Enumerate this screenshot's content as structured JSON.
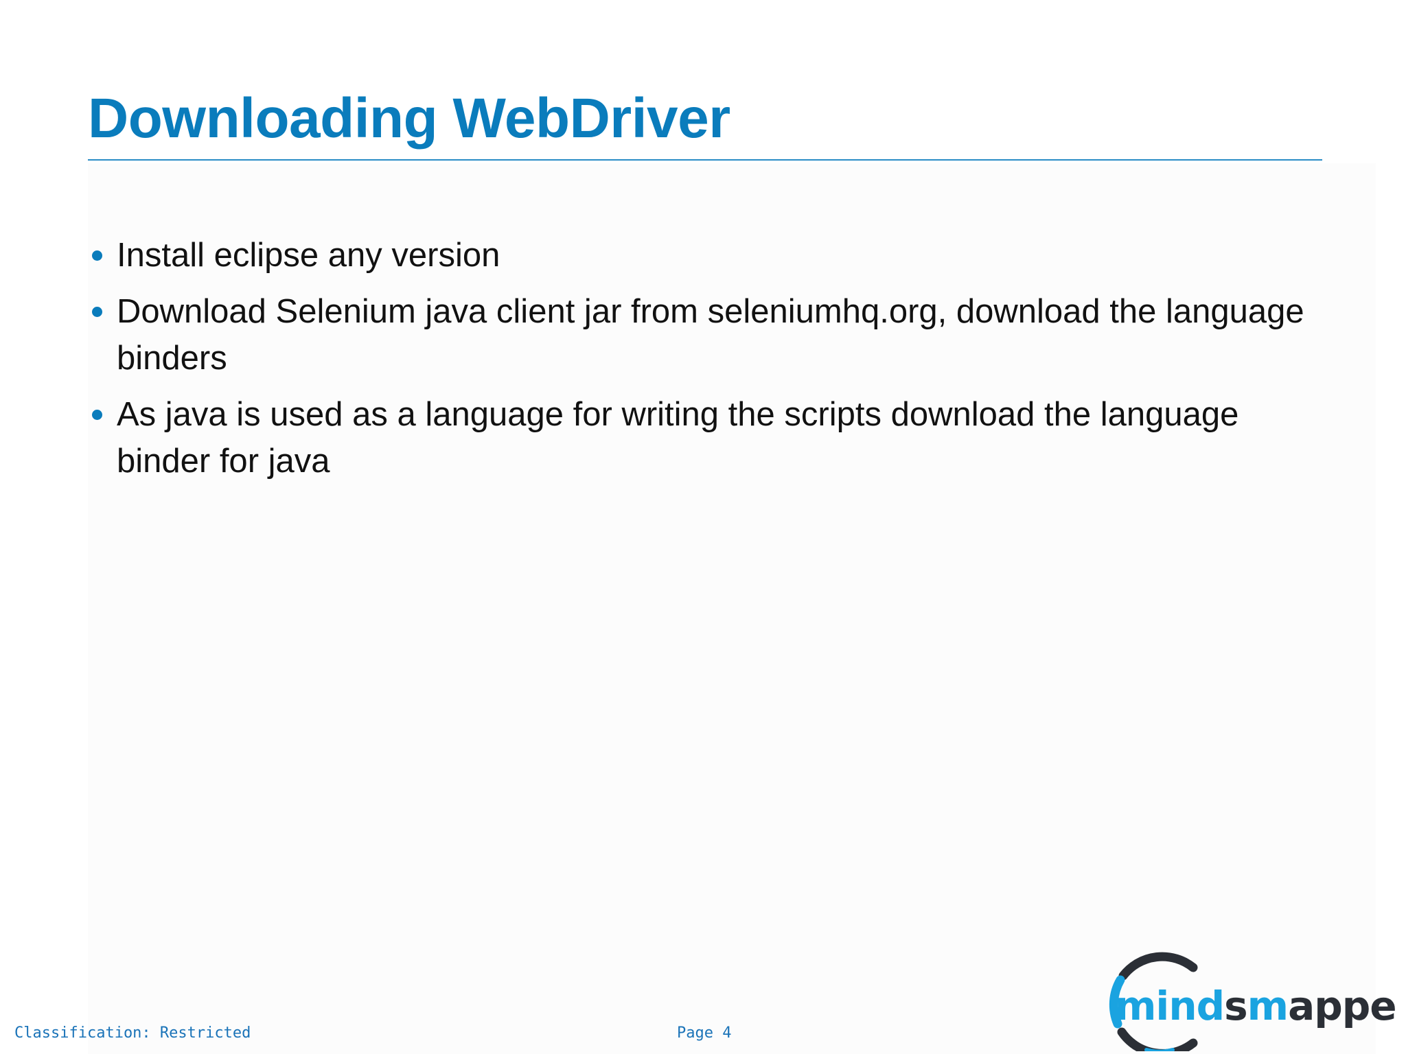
{
  "slide": {
    "title": "Downloading WebDriver",
    "bullets": [
      "Install eclipse any version",
      "Download Selenium java client jar from seleniumhq.org, download the language binders",
      "As java is used as a language for writing the scripts download the language binder for java"
    ]
  },
  "footer": {
    "classification": "Classification: Restricted",
    "page": "Page 4"
  },
  "logo": {
    "text_part1": "mind",
    "text_part2": "s",
    "text_part3": "m",
    "text_part4": "apped",
    "colors": {
      "blue": "#1aa3e0",
      "dark": "#2b2f36"
    }
  },
  "colors": {
    "title": "#0a7cbc",
    "bullet": "#0a7cbc",
    "footer": "#1a73b8"
  }
}
